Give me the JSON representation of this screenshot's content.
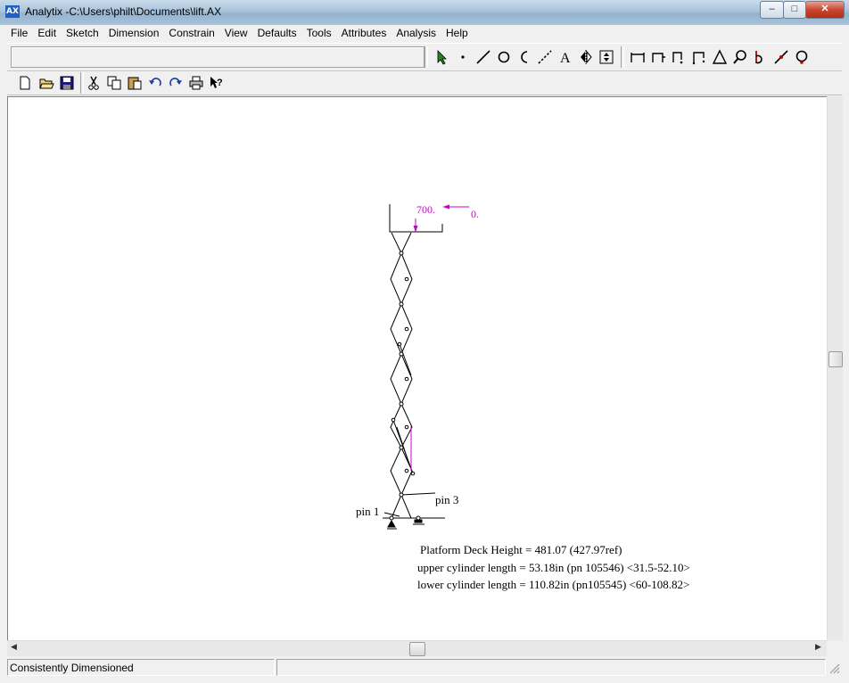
{
  "window": {
    "title": "Analytix -C:\\Users\\philt\\Documents\\lift.AX"
  },
  "menu": [
    "File",
    "Edit",
    "Sketch",
    "Dimension",
    "Constrain",
    "View",
    "Defaults",
    "Tools",
    "Attributes",
    "Analysis",
    "Help"
  ],
  "toolbar_sketch_icons": [
    "select-arrow-icon",
    "point-icon",
    "line-icon",
    "circle-icon",
    "arc-icon",
    "construction-line-icon",
    "text-icon",
    "mirror-icon",
    "group-icon"
  ],
  "toolbar_dimension_icons": [
    "horizontal-dimension-icon",
    "vertical-dimension-icon",
    "distance-dimension-icon",
    "angle-dimension-icon",
    "triangle-dimension-icon",
    "zoom-icon",
    "radius-dimension-icon",
    "diagonal-dimension-icon",
    "diameter-dimension-icon"
  ],
  "toolbar_file_icons": [
    "new-file-icon",
    "open-folder-icon",
    "save-icon",
    "cut-icon",
    "copy-icon",
    "paste-icon",
    "undo-icon",
    "redo-icon",
    "print-icon",
    "context-help-icon"
  ],
  "drawing": {
    "dimension_top": "700.",
    "dimension_side": "0.",
    "pin1_label": "pin 1",
    "pin3_label": "pin 3",
    "results": [
      "Platform Deck Height = 481.07 (427.97ref)",
      "upper cylinder length = 53.18in (pn 105546) <31.5-52.10>",
      "lower cylinder length = 110.82in (pn105545) <60-108.82>"
    ]
  },
  "status": {
    "message": "Consistently Dimensioned"
  },
  "colors": {
    "dimension": "#cc00cc",
    "titlebar": "#a9c3da"
  }
}
